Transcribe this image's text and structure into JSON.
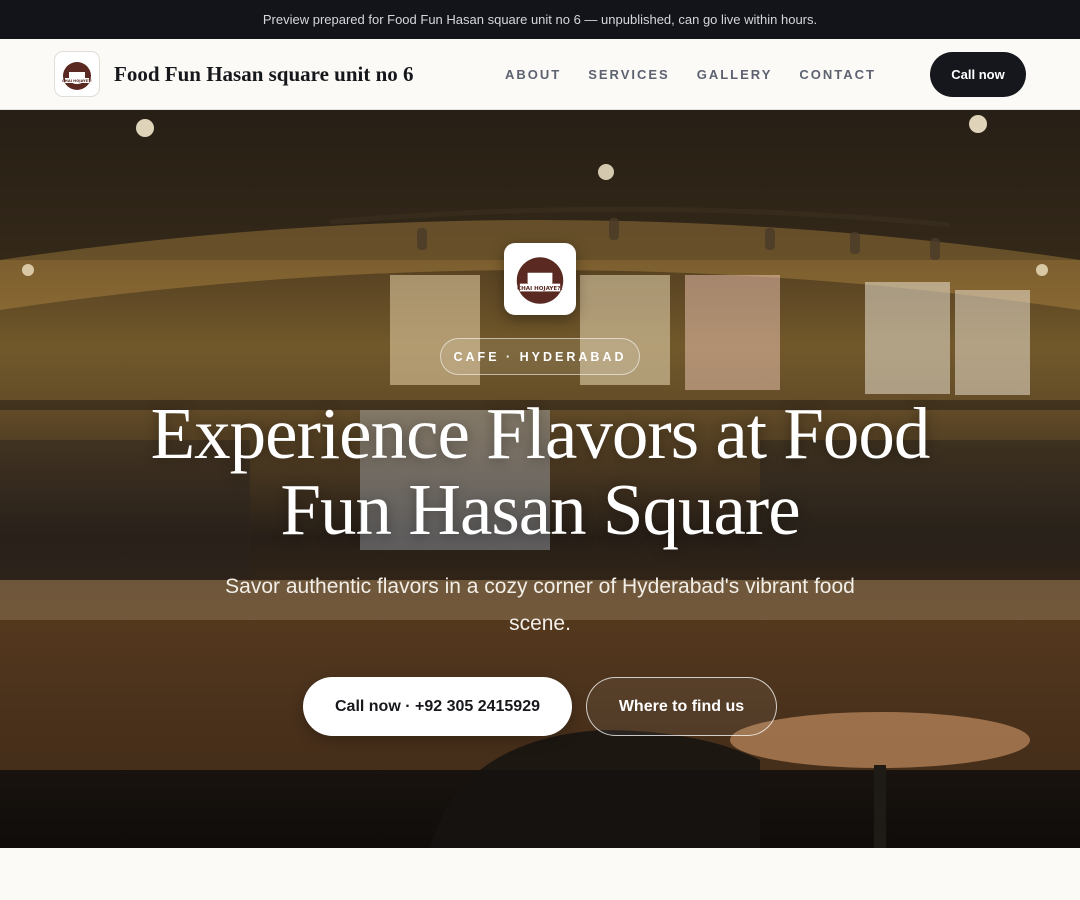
{
  "preview_banner": "Preview prepared for Food Fun Hasan square unit no 6 — unpublished, can go live within hours.",
  "header": {
    "brand_name": "Food Fun Hasan square unit no 6",
    "logo_text": "CHAI HOJAYE?!",
    "nav": [
      {
        "label": "ABOUT"
      },
      {
        "label": "SERVICES"
      },
      {
        "label": "GALLERY"
      },
      {
        "label": "CONTACT"
      }
    ],
    "cta_label": "Call now"
  },
  "hero": {
    "badge": "CAFE · HYDERABAD",
    "title": "Experience Flavors at Food Fun Hasan Square",
    "subtitle": "Savor authentic flavors in a cozy corner of Hyderabad's vibrant food scene.",
    "primary_button": "Call now · +92 305 2415929",
    "secondary_button": "Where to find us"
  },
  "colors": {
    "top_banner_bg": "#121419",
    "nav_cta_bg": "#15171c",
    "page_bg": "#fbfaf7",
    "logo_brown": "#5a2a22"
  },
  "icons": [
    "chai-cup-logo-icon"
  ]
}
